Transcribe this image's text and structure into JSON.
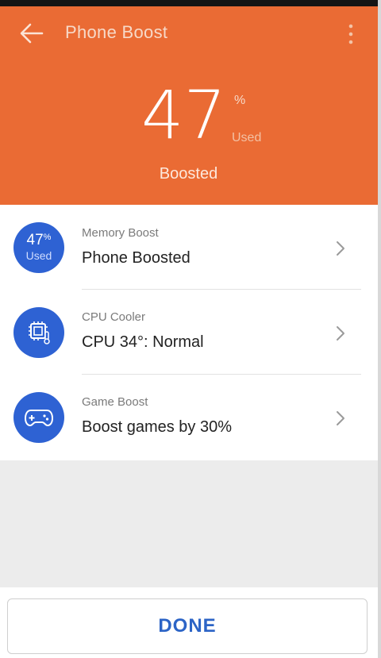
{
  "header": {
    "title": "Phone Boost",
    "percent_value": "47",
    "percent_sign": "%",
    "used_label": "Used",
    "boosted_label": "Boosted",
    "back_icon": "arrow-left-icon",
    "menu_icon": "more-vert-icon",
    "background_color": "#ea6b34"
  },
  "rows": [
    {
      "icon_value": "47",
      "icon_sign": "%",
      "icon_sub": "Used",
      "caption": "Memory Boost",
      "value": "Phone Boosted"
    },
    {
      "icon": "cpu-thermometer-icon",
      "caption": "CPU Cooler",
      "value": "CPU 34°: Normal"
    },
    {
      "icon": "gamepad-icon",
      "caption": "Game Boost",
      "value": "Boost games by 30%"
    }
  ],
  "footer": {
    "done_label": "DONE",
    "accent_color": "#2e62d3"
  }
}
